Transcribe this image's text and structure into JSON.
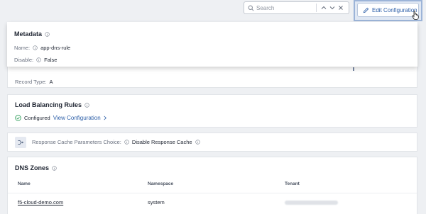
{
  "search": {
    "placeholder": "Search",
    "up": "∧",
    "down": "∨",
    "close": "×"
  },
  "edit_button": {
    "label": "Edit Configuration"
  },
  "metadata": {
    "title": "Metadata",
    "name_label": "Name:",
    "name_value": "app-dns-rule",
    "disable_label": "Disable:",
    "disable_value": "False"
  },
  "record": {
    "label": "Record Type:",
    "value": "A"
  },
  "load_balancing": {
    "title": "Load Balancing Rules",
    "status": "Configured",
    "link": "View Configuration"
  },
  "response_cache": {
    "label": "Response Cache Parameters Choice:",
    "value": "Disable Response Cache"
  },
  "dns_zones": {
    "title": "DNS Zones",
    "columns": [
      "Name",
      "Namespace",
      "Tenant"
    ],
    "rows": [
      {
        "name": "f5-cloud-demo.com",
        "namespace": "system",
        "tenant": ""
      }
    ]
  },
  "colors": {
    "accent": "#2d5fa8",
    "success": "#2f9e5b"
  }
}
